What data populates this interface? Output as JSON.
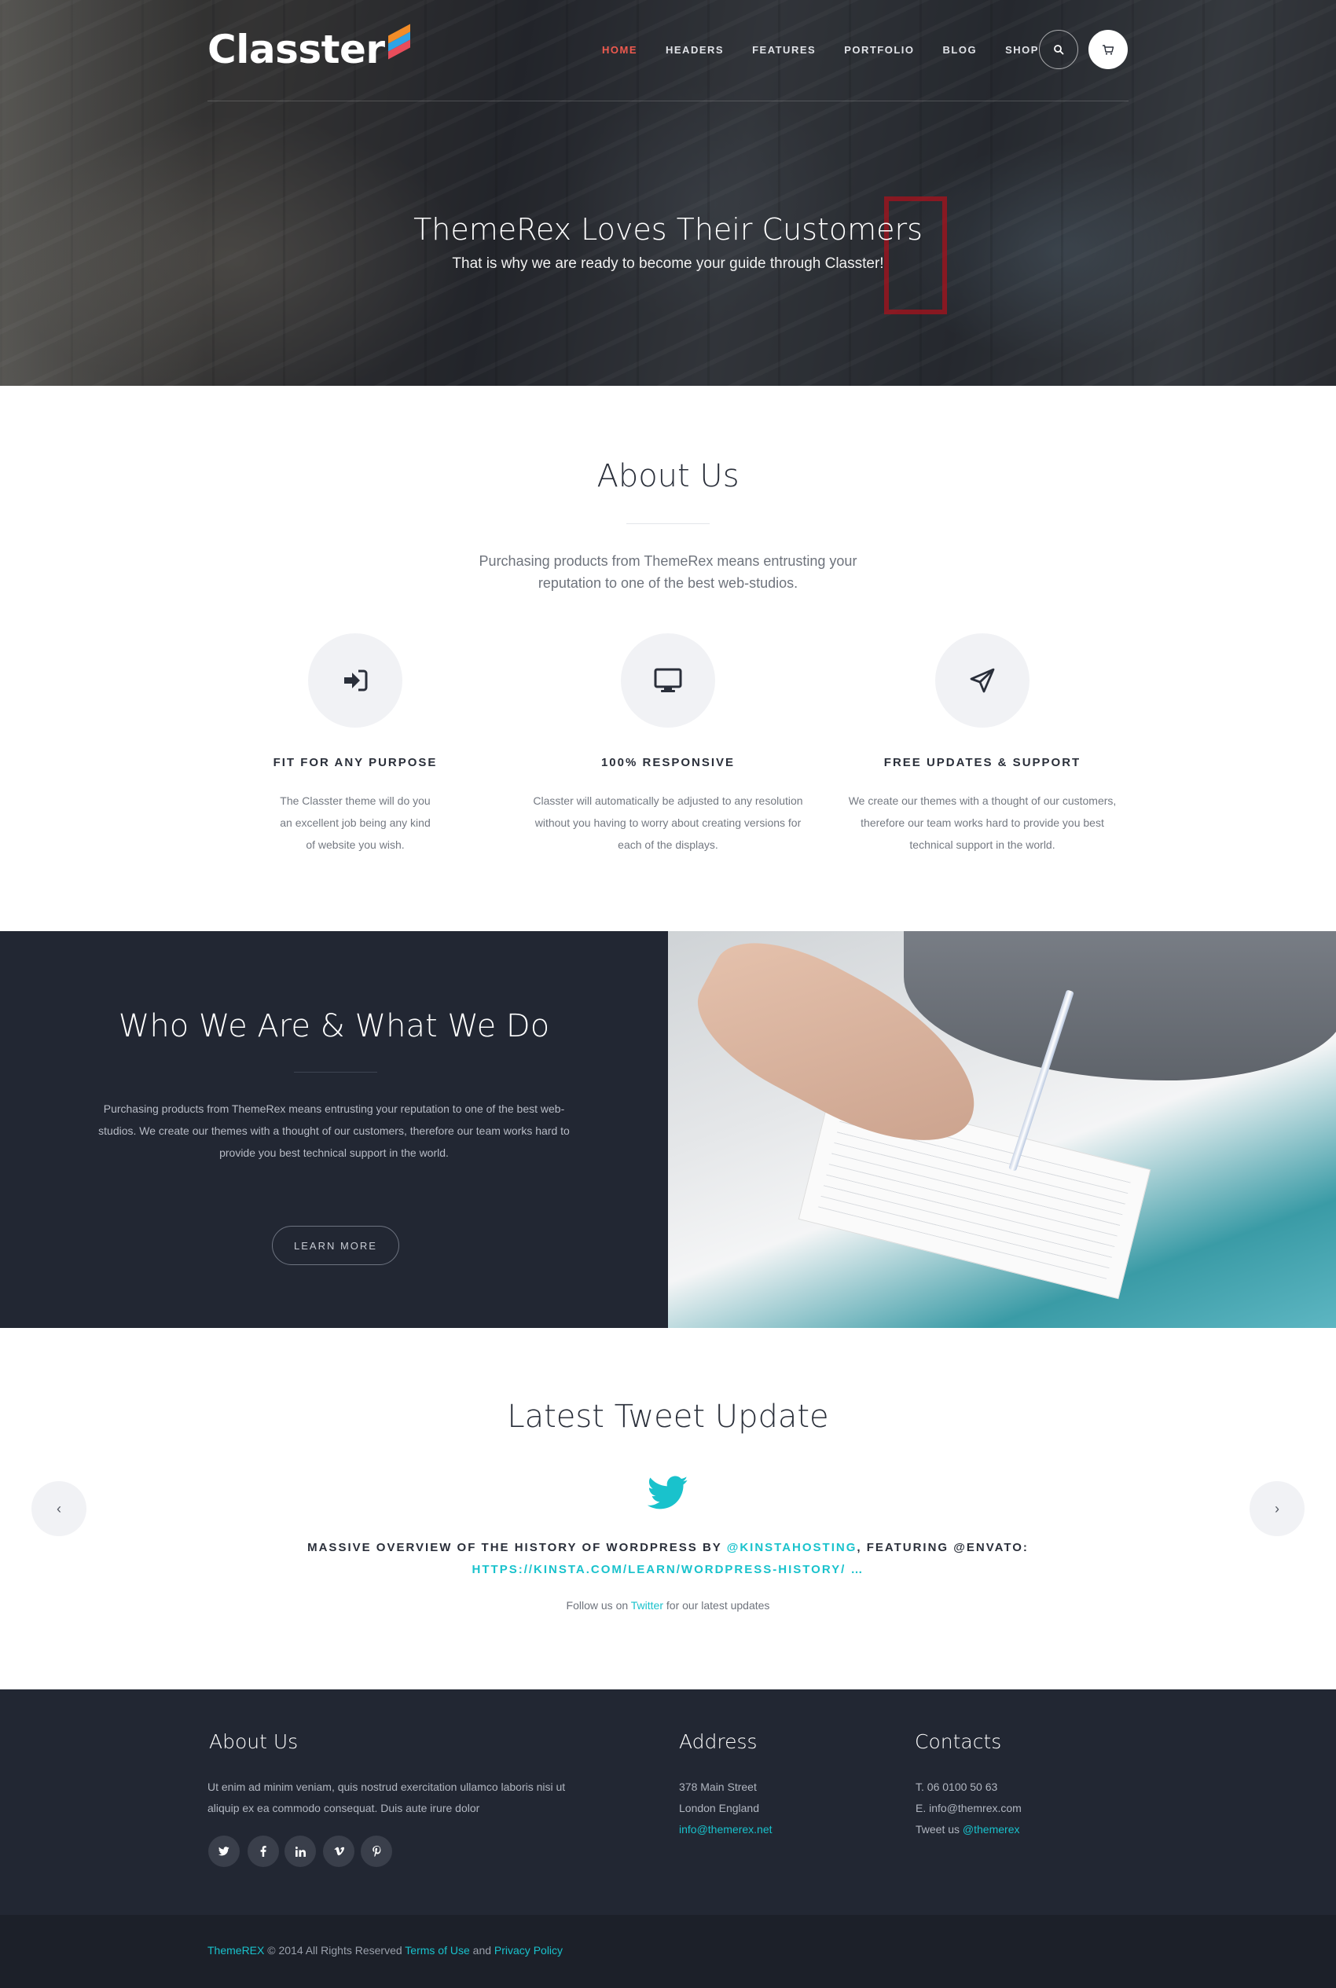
{
  "header": {
    "logo": "Classter",
    "nav": [
      "HOME",
      "HEADERS",
      "FEATURES",
      "PORTFOLIO",
      "BLOG",
      "SHOP"
    ],
    "active_nav": "HOME"
  },
  "hero": {
    "title": "ThemeRex Loves Their Customers",
    "subtitle": "That is why we are ready to become your guide through Classter!"
  },
  "about": {
    "title": "About Us",
    "text": "Purchasing products from ThemeRex means entrusting your reputation to one of the best web-studios.",
    "features": [
      {
        "icon": "sign-in-icon",
        "title": "FIT FOR ANY PURPOSE",
        "text": "The Classter theme will do you an excellent job being any kind of website you wish."
      },
      {
        "icon": "monitor-icon",
        "title": "100% RESPONSIVE",
        "text": "Classter will automatically be adjusted to any resolution without you having to worry about creating versions for each of the displays."
      },
      {
        "icon": "paper-plane-icon",
        "title": "FREE UPDATES & SUPPORT",
        "text": "We create our themes with a thought of our customers, therefore our team works hard to provide you best technical support in the world."
      }
    ]
  },
  "who": {
    "title": "Who We Are & What We Do",
    "text": "Purchasing products from ThemeRex means entrusting your reputation to one of the best web-studios. We create our themes with a thought of our customers, therefore our team works hard to provide you best technical support in the world.",
    "button": "LEARN MORE"
  },
  "tweet": {
    "title": "Latest Tweet Update",
    "text_start": "MASSIVE OVERVIEW OF THE HISTORY OF WORDPRESS BY ",
    "mention": "@KINSTAHOSTING",
    "text_mid": ", FEATURING @ENVATO:",
    "link": "HTTPS://KINSTA.COM/LEARN/WORDPRESS-HISTORY/ …",
    "follow_start": "Follow us on ",
    "follow_link": "Twitter",
    "follow_end": " for our latest updates",
    "prev": "‹",
    "next": "›"
  },
  "footer": {
    "about_title": "About Us",
    "about_text": "Ut enim ad minim veniam, quis nostrud exercitation ullamco laboris nisi ut aliquip ex ea commodo consequat. Duis aute irure dolor",
    "socials": [
      "twitter-icon",
      "facebook-icon",
      "linkedin-icon",
      "vimeo-icon",
      "pinterest-icon"
    ],
    "address_title": "Address",
    "address_line1": "378 Main Street",
    "address_line2": "London England",
    "address_email": "info@themerex.net",
    "contacts_title": "Contacts",
    "contacts_phone": "T. 06 0100 50 63",
    "contacts_email": "E. info@themrex.com",
    "contacts_tweet_label": "Tweet us ",
    "contacts_tweet_handle": "@themerex"
  },
  "bottom": {
    "brand": "ThemeREX",
    "copyright": " © 2014 All Rights Reserved ",
    "terms": "Terms of Use",
    "and": " and ",
    "privacy": "Privacy Policy"
  },
  "colors": {
    "accent": "#19c2cc",
    "nav_active": "#ef5a4f",
    "dark": "#222733"
  }
}
